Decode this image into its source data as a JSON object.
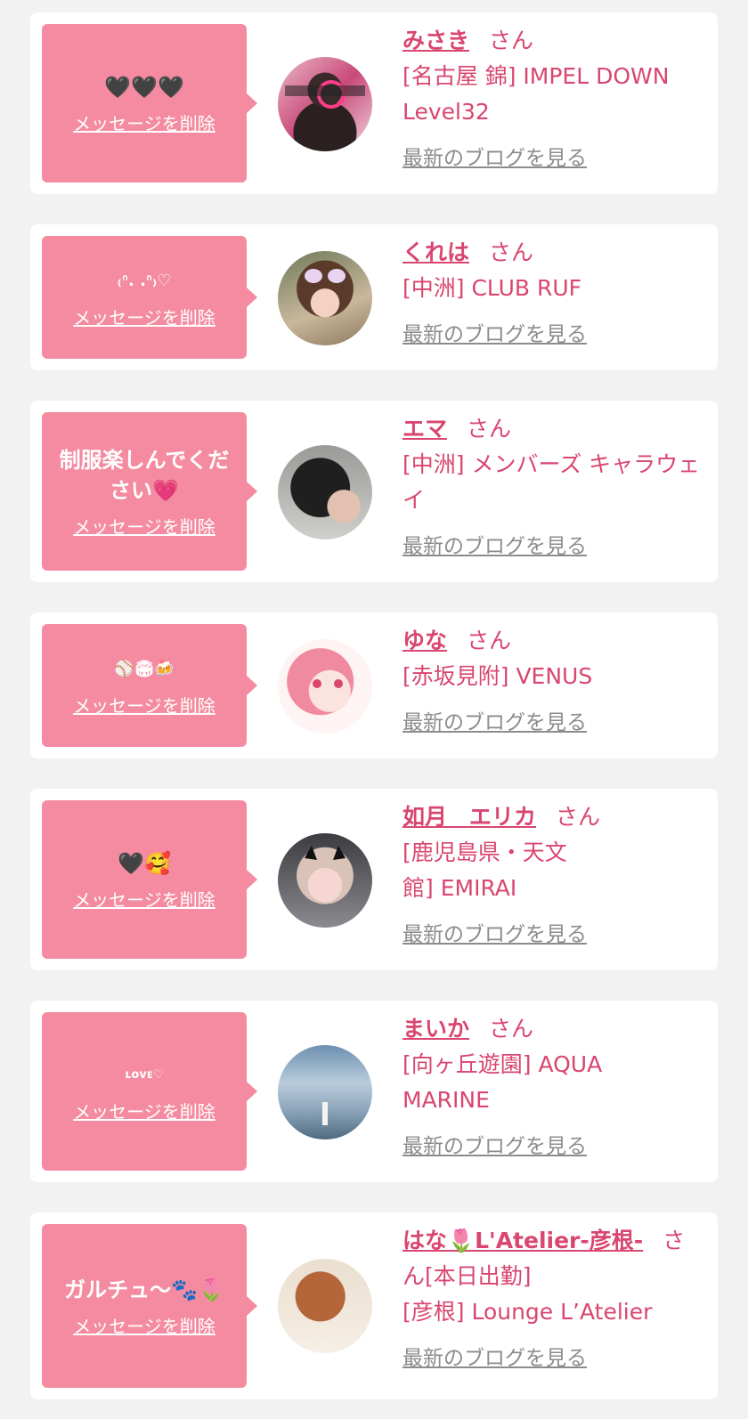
{
  "entries": [
    {
      "message": "🖤🖤🖤",
      "delete_label": "メッセージを削除",
      "name": "みさき",
      "honorific": "さん",
      "shop": "[名古屋 錦] IMPEL DOWN Level32",
      "blog_label": "最新のブログを見る"
    },
    {
      "message": "₍ᐢ. .ᐢ₎♡",
      "delete_label": "メッセージを削除",
      "name": "くれは",
      "honorific": "さん",
      "shop": "[中洲] CLUB RUF",
      "blog_label": "最新のブログを見る"
    },
    {
      "message": "制服楽しんでください💗",
      "delete_label": "メッセージを削除",
      "name": "エマ",
      "honorific": "さん",
      "shop": "[中洲] メンバーズ キャラウェイ",
      "blog_label": "最新のブログを見る"
    },
    {
      "message": "⚾🏟🍻",
      "delete_label": "メッセージを削除",
      "name": "ゆな",
      "honorific": "さん",
      "shop": "[赤坂見附] VENUS",
      "blog_label": "最新のブログを見る"
    },
    {
      "message": "🖤🥰",
      "delete_label": "メッセージを削除",
      "name": "如月　エリカ",
      "honorific": "さん",
      "shop": "[鹿児島県・天文館] EMIRAI",
      "blog_label": "最新のブログを見る"
    },
    {
      "message": "ʟᴏᴠᴇ♡",
      "delete_label": "メッセージを削除",
      "name": "まいか",
      "honorific": "さん",
      "shop": "[向ヶ丘遊園] AQUA MARINE",
      "blog_label": "最新のブログを見る"
    },
    {
      "message": "ガルチュ〜🐾🌷",
      "delete_label": "メッセージを削除",
      "name": "はな🌷L'Atelier-彦根-",
      "honorific": "さん[本日出勤]",
      "shop": "[彦根] Lounge L’Atelier",
      "blog_label": "最新のブログを見る"
    }
  ],
  "colors": {
    "bubble": "#f48ba0",
    "name_text": "#d94670",
    "link_gray": "#8c8c8c",
    "background": "#f2f2f2"
  }
}
